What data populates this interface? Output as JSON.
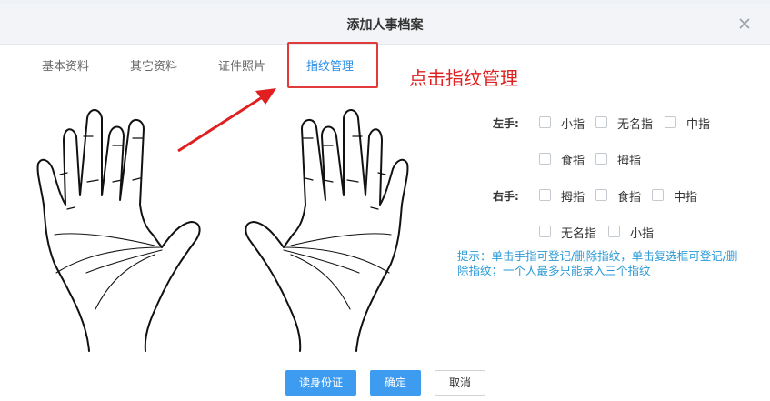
{
  "dialog": {
    "title": "添加人事档案"
  },
  "tabs": [
    {
      "label": "基本资料"
    },
    {
      "label": "其它资料"
    },
    {
      "label": "证件照片"
    },
    {
      "label": "指纹管理"
    }
  ],
  "active_tab": "指纹管理",
  "annotation": {
    "text": "点击指纹管理",
    "color": "#e02020"
  },
  "fingerprint": {
    "left_label": "左手:",
    "right_label": "右手:",
    "left_fingers": [
      "小指",
      "无名指",
      "中指",
      "食指",
      "拇指"
    ],
    "right_fingers": [
      "拇指",
      "食指",
      "中指",
      "无名指",
      "小指"
    ],
    "hint": "提示：单击手指可登记/删除指纹，单击复选框可登记/删除指纹；一个人最多只能录入三个指纹"
  },
  "footer": {
    "read_id_label": "读身份证",
    "confirm_label": "确定",
    "cancel_label": "取消"
  },
  "colors": {
    "accent": "#3e9cf0",
    "active_tab": "#2b8de6",
    "hint": "#2b9ad6",
    "annotation": "#e02020"
  }
}
